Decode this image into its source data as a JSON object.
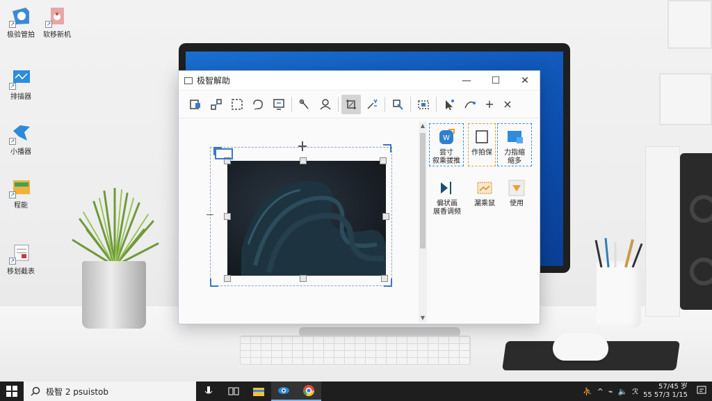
{
  "desktop": {
    "icons": [
      {
        "label": "极验管拍"
      },
      {
        "label": "软移新机"
      },
      {
        "label": "排描器"
      },
      {
        "label": "小播器"
      },
      {
        "label": "程能"
      },
      {
        "label": "移划截表"
      }
    ]
  },
  "window": {
    "title": "极智解助",
    "minimize": "—",
    "maximize": "☐",
    "close": "✕"
  },
  "toolbar": {
    "plus": "+",
    "close": "×"
  },
  "side_panel": {
    "items": [
      {
        "label": "尝寸\n叙乘拔推"
      },
      {
        "label": "作拍保"
      },
      {
        "label": "力指缩\n缩多"
      },
      {
        "label": "偏状画\n展香调频"
      },
      {
        "label": "漏乘鼠"
      },
      {
        "label": "使用"
      }
    ]
  },
  "taskbar": {
    "search_text": "极智 2 psuistob",
    "clock_time": "57/45 岁",
    "clock_date": "55 57/3 1/15"
  },
  "colors": {
    "accent": "#1a6fd1",
    "selection": "#3a78c8",
    "taskbar": "#1e1e1e"
  }
}
